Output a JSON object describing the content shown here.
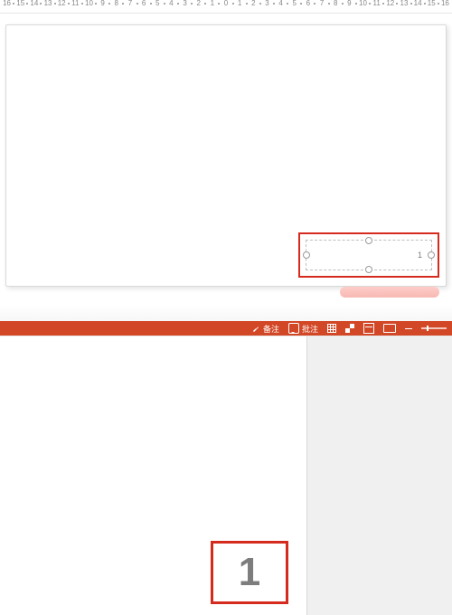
{
  "ruler": {
    "ticks": [
      "16",
      "15",
      "14",
      "13",
      "12",
      "11",
      "10",
      "9",
      "8",
      "7",
      "6",
      "5",
      "4",
      "3",
      "2",
      "1",
      "0",
      "1",
      "2",
      "3",
      "4",
      "5",
      "6",
      "7",
      "8",
      "9",
      "10",
      "11",
      "12",
      "13",
      "14",
      "15",
      "16"
    ]
  },
  "textbox": {
    "page_number": "1"
  },
  "status": {
    "notes_label": "备注",
    "comments_label": "批注"
  },
  "preview": {
    "page_number": "1"
  }
}
